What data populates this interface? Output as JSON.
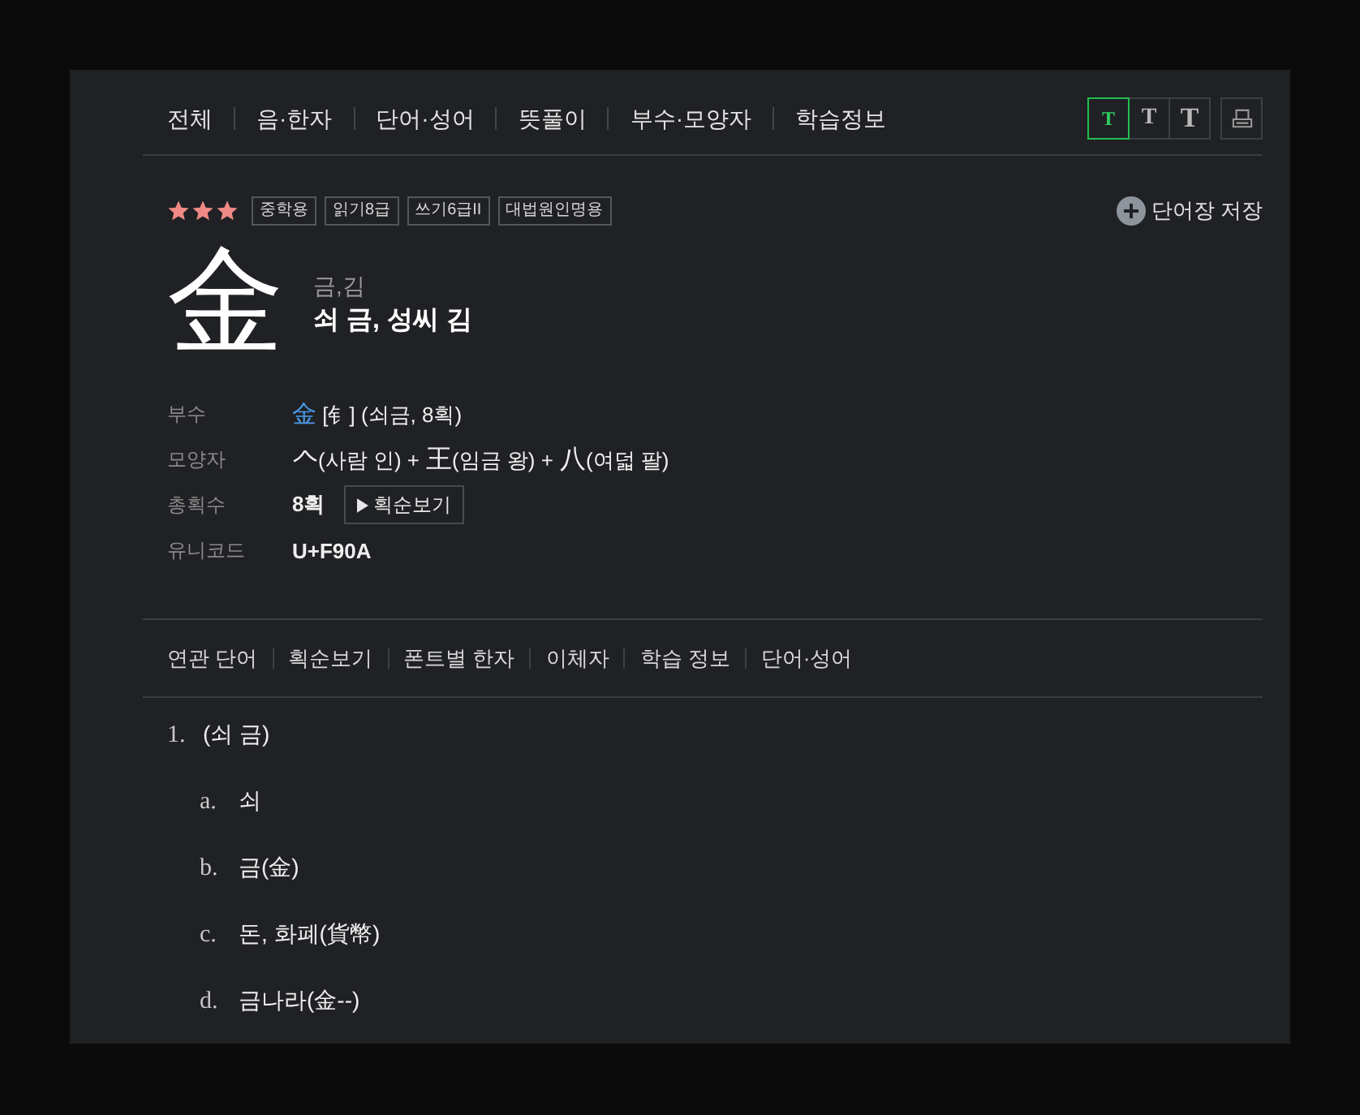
{
  "top_nav": [
    "전체",
    "음·한자",
    "단어·성어",
    "뜻풀이",
    "부수·모양자",
    "학습정보"
  ],
  "font_sizes": [
    {
      "label": "T",
      "selected": true
    },
    {
      "label": "T",
      "selected": false
    },
    {
      "label": "T",
      "selected": false
    }
  ],
  "entry": {
    "stars": 3,
    "tags": [
      "중학용",
      "읽기8급",
      "쓰기6급II",
      "대법원인명용"
    ],
    "save_label": "단어장 저장",
    "hanja": "金",
    "readings": "금,김",
    "meaning": "쇠 금, 성씨 김"
  },
  "info": [
    {
      "label": "부수",
      "kind": "radical",
      "char": "金",
      "value": "[钅] (쇠금, 8획)"
    },
    {
      "label": "모양자",
      "kind": "composition",
      "parts": [
        {
          "char": "𠆢",
          "text": "(사람 인) +"
        },
        {
          "char": "王",
          "text": "(임금 왕) +"
        },
        {
          "char": "八",
          "text": "(여덟 팔)"
        }
      ]
    },
    {
      "label": "총획수",
      "kind": "strokes",
      "value": "8획",
      "button": "획순보기"
    },
    {
      "label": "유니코드",
      "kind": "text",
      "value": "U+F90A"
    }
  ],
  "sub_nav": [
    "연관 단어",
    "획순보기",
    "폰트별 한자",
    "이체자",
    "학습 정보",
    "단어·성어"
  ],
  "definitions": [
    {
      "number": "1.",
      "text": "(쇠 금)",
      "children": [
        {
          "marker": "a.",
          "text": "쇠"
        },
        {
          "marker": "b.",
          "text": "금(金)"
        },
        {
          "marker": "c.",
          "text": "돈, 화폐(貨幣)"
        },
        {
          "marker": "d.",
          "text": "금나라(金--)"
        }
      ]
    }
  ]
}
